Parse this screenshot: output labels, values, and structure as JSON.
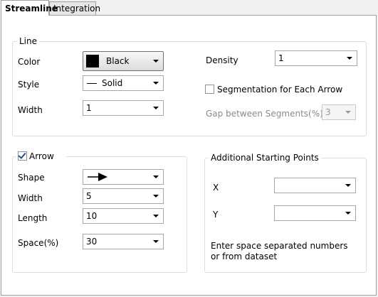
{
  "tabs": [
    {
      "label": "Streamline",
      "active": true
    },
    {
      "label": "Integration",
      "active": false
    }
  ],
  "line_group": {
    "title": "Line",
    "color": {
      "label": "Color",
      "value": "Black",
      "swatch": "#000000"
    },
    "style": {
      "label": "Style",
      "value": "Solid",
      "icon": "solid-line-icon"
    },
    "width": {
      "label": "Width",
      "value": "1"
    },
    "density": {
      "label": "Density",
      "value": "1"
    },
    "segmentation": {
      "label": "Segmentation for Each Arrow",
      "checked": false
    },
    "gap": {
      "label": "Gap between Segments(%)",
      "value": "3",
      "disabled": true
    }
  },
  "arrow_group": {
    "title": "Arrow",
    "checked": true,
    "shape": {
      "label": "Shape",
      "icon": "arrow-right-icon"
    },
    "width": {
      "label": "Width",
      "value": "5"
    },
    "length": {
      "label": "Length",
      "value": "10"
    },
    "space": {
      "label": "Space(%)",
      "value": "30"
    }
  },
  "starting_points": {
    "title": "Additional Starting Points",
    "x": {
      "label": "X",
      "value": ""
    },
    "y": {
      "label": "Y",
      "value": ""
    },
    "hint": "Enter space separated numbers or from dataset"
  }
}
